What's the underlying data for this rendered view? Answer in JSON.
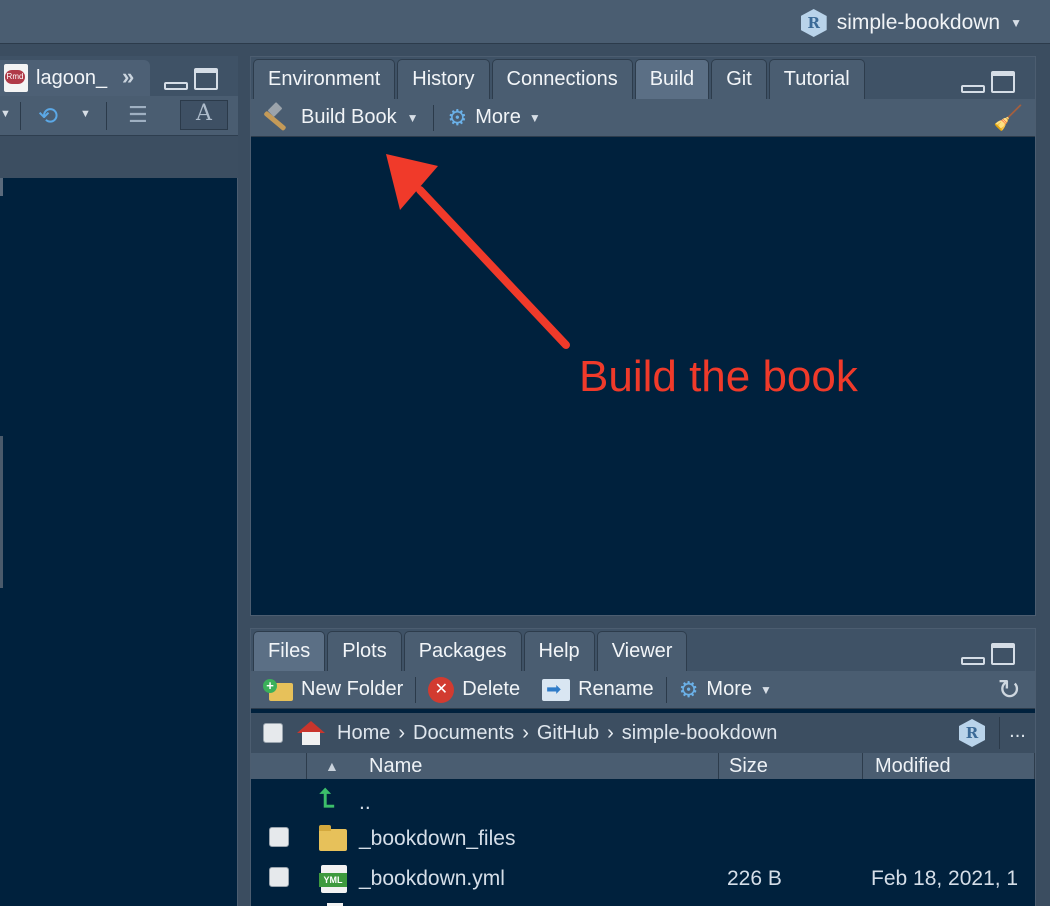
{
  "project": {
    "name": "simple-bookdown"
  },
  "left_pane": {
    "tab_label": "lagoon_"
  },
  "build_pane": {
    "tabs": [
      "Environment",
      "History",
      "Connections",
      "Build",
      "Git",
      "Tutorial"
    ],
    "active_tab": "Build",
    "toolbar": {
      "build_label": "Build Book",
      "more_label": "More"
    }
  },
  "annotation": {
    "text": "Build the book",
    "color": "#f03a2a"
  },
  "files_pane": {
    "tabs": [
      "Files",
      "Plots",
      "Packages",
      "Help",
      "Viewer"
    ],
    "active_tab": "Files",
    "toolbar": {
      "new_folder": "New Folder",
      "delete": "Delete",
      "rename": "Rename",
      "more": "More"
    },
    "breadcrumb": [
      "Home",
      "Documents",
      "GitHub",
      "simple-bookdown"
    ],
    "ellipsis": "...",
    "columns": {
      "name": "Name",
      "size": "Size",
      "modified": "Modified"
    },
    "rows": [
      {
        "name": "..",
        "size": "",
        "modified": "",
        "icon": "up-arrow-icon"
      },
      {
        "name": "_bookdown_files",
        "size": "",
        "modified": "",
        "icon": "folder-icon"
      },
      {
        "name": "_bookdown.yml",
        "size": "226 B",
        "modified": "Feb 18, 2021, 1",
        "icon": "yml-file-icon"
      }
    ]
  }
}
